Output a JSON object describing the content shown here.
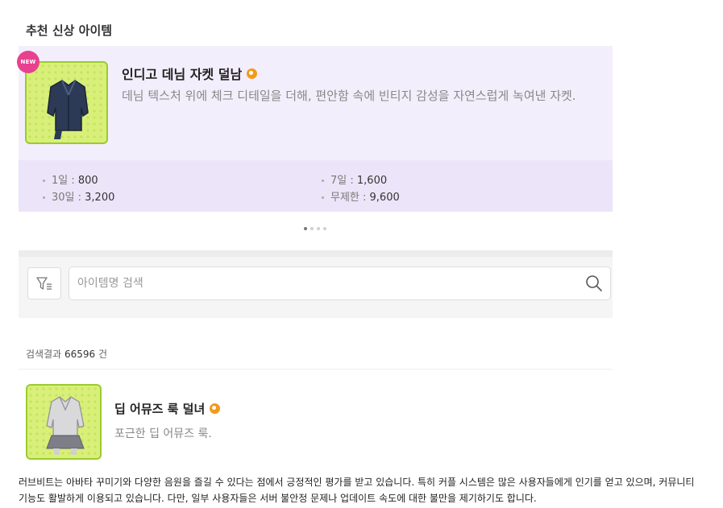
{
  "section_title": "추천 신상 아이템",
  "recommended": {
    "badge": "NEW",
    "name": "인디고 데님 자켓 덜남",
    "description": "데님 텍스처 위에 체크 디테일을 더해, 편안함 속에 빈티지 감성을 자연스럽게 녹여낸 자켓.",
    "prices": [
      {
        "label": "1일 : ",
        "value": "800"
      },
      {
        "label": "7일 : ",
        "value": "1,600"
      },
      {
        "label": "30일 : ",
        "value": "3,200"
      },
      {
        "label": "무제한 : ",
        "value": "9,600"
      }
    ]
  },
  "pager": {
    "count": 4,
    "active": 1
  },
  "search": {
    "placeholder": "아이템명 검색",
    "value": ""
  },
  "results": {
    "prefix": "검색결과 ",
    "count": "66596",
    "suffix": " 건"
  },
  "item": {
    "name": "딥 어뮤즈 룩 덜녀",
    "description": "포근한 딥 어뮤즈 룩."
  },
  "footer_text": "러브비트는 아바타 꾸미기와 다양한 음원을 즐길 수 있다는 점에서 긍정적인 평가를 받고 있습니다. 특히 커플 시스템은 많은 사용자들에게 인기를 얻고 있으며, 커뮤니티 기능도 활발하게 이용되고 있습니다. 다만, 일부 사용자들은 서버 불안정 문제나 업데이트 속도에 대한 불만을 제기하기도 합니다.",
  "colors": {
    "card_bg": "#f3eefb",
    "price_bg": "#ece5f9",
    "badge": "#e8418f",
    "coin": "#f39a1a",
    "thumb_bg": "#d8f07a",
    "thumb_border": "#9bcb2e"
  },
  "icons": [
    "coin-icon",
    "filter-icon",
    "search-icon",
    "jacket-icon",
    "outfit-icon"
  ]
}
